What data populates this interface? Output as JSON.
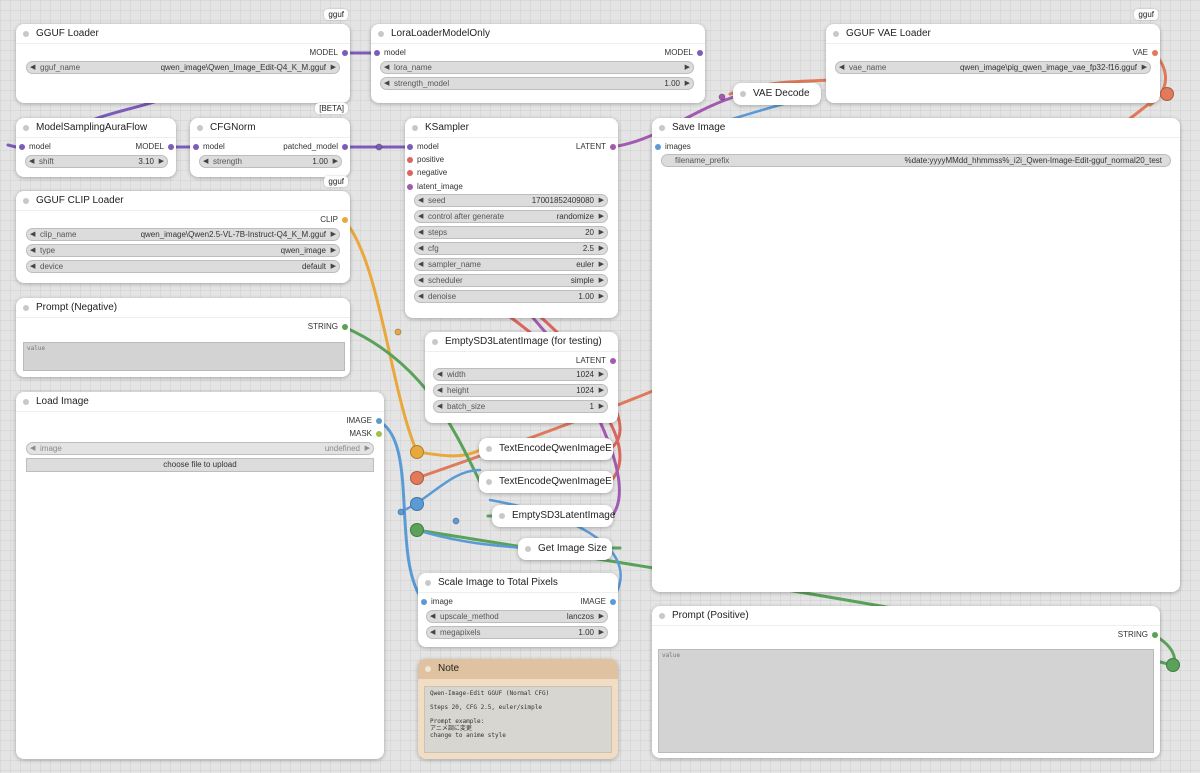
{
  "colors": {
    "model": "#7b5cba",
    "latent": "#a25ab0",
    "clip": "#e8a83c",
    "string": "#5aa25a",
    "image": "#5b9bd5",
    "mask": "#9fbf4a",
    "vae": "#e07a5a",
    "conditioning_pos": "#d9665e",
    "conditioning_neg": "#e89a8c"
  },
  "nodes": {
    "gguf_loader": {
      "badge": "gguf",
      "title": "GGUF Loader",
      "out_model": "MODEL",
      "w_gguf_name": {
        "label": "gguf_name",
        "value": "qwen_image\\Qwen_Image_Edit-Q4_K_M.gguf"
      }
    },
    "lora_loader": {
      "title": "LoraLoaderModelOnly",
      "in_model": "model",
      "out_model": "MODEL",
      "w_lora_name": {
        "label": "lora_name",
        "value": ""
      },
      "w_strength": {
        "label": "strength_model",
        "value": "1.00"
      }
    },
    "vae_decode": {
      "title": "VAE Decode"
    },
    "gguf_vae_loader": {
      "badge": "gguf",
      "title": "GGUF VAE Loader",
      "out_vae": "VAE",
      "w_vae_name": {
        "label": "vae_name",
        "value": "qwen_image\\pig_qwen_image_vae_fp32-f16.gguf"
      }
    },
    "model_sampling": {
      "title": "ModelSamplingAuraFlow",
      "in_model": "model",
      "out_model": "MODEL",
      "w_shift": {
        "label": "shift",
        "value": "3.10"
      }
    },
    "cfg_norm": {
      "badge": "[BETA]",
      "title": "CFGNorm",
      "in_model": "model",
      "out_model": "patched_model",
      "w_strength": {
        "label": "strength",
        "value": "1.00"
      }
    },
    "ksampler": {
      "title": "KSampler",
      "in_model": "model",
      "in_positive": "positive",
      "in_negative": "negative",
      "in_latent": "latent_image",
      "out_latent": "LATENT",
      "w_seed": {
        "label": "seed",
        "value": "17001852409080"
      },
      "w_control": {
        "label": "control after generate",
        "value": "randomize"
      },
      "w_steps": {
        "label": "steps",
        "value": "20"
      },
      "w_cfg": {
        "label": "cfg",
        "value": "2.5"
      },
      "w_sampler": {
        "label": "sampler_name",
        "value": "euler"
      },
      "w_scheduler": {
        "label": "scheduler",
        "value": "simple"
      },
      "w_denoise": {
        "label": "denoise",
        "value": "1.00"
      }
    },
    "save_image": {
      "title": "Save Image",
      "in_images": "images",
      "w_prefix": {
        "label": "filename_prefix",
        "value": "%date:yyyyMMdd_hhmmss%_i2i_Qwen-Image-Edit-gguf_normal20_test"
      }
    },
    "clip_loader": {
      "badge": "gguf",
      "title": "GGUF CLIP Loader",
      "out_clip": "CLIP",
      "w_clip_name": {
        "label": "clip_name",
        "value": "qwen_image\\Qwen2.5-VL-7B-Instruct-Q4_K_M.gguf"
      },
      "w_type": {
        "label": "type",
        "value": "qwen_image"
      },
      "w_device": {
        "label": "device",
        "value": "default"
      }
    },
    "prompt_negative": {
      "title": "Prompt (Negative)",
      "out_string": "STRING",
      "placeholder": "value"
    },
    "load_image": {
      "title": "Load Image",
      "out_image": "IMAGE",
      "out_mask": "MASK",
      "w_image": {
        "label": "image",
        "value": "undefined"
      },
      "upload_label": "choose file to upload"
    },
    "empty_sd3_testing": {
      "title": "EmptySD3LatentImage (for testing)",
      "out_latent": "LATENT",
      "w_width": {
        "label": "width",
        "value": "1024"
      },
      "w_height": {
        "label": "height",
        "value": "1024"
      },
      "w_batch": {
        "label": "batch_size",
        "value": "1"
      }
    },
    "text_encode_1": {
      "title": "TextEncodeQwenImageE"
    },
    "text_encode_2": {
      "title": "TextEncodeQwenImageE"
    },
    "empty_sd3_collapsed": {
      "title": "EmptySD3LatentImage"
    },
    "get_image_size": {
      "title": "Get Image Size"
    },
    "scale_image": {
      "title": "Scale Image to Total Pixels",
      "in_image": "image",
      "out_image": "IMAGE",
      "w_method": {
        "label": "upscale_method",
        "value": "lanczos"
      },
      "w_megapixels": {
        "label": "megapixels",
        "value": "1.00"
      }
    },
    "note": {
      "title": "Note",
      "text": "Qwen-Image-Edit GGUF (Normal CFG)\n\nSteps 20, CFG 2.5, euler/simple\n\nPrompt example:\nアニメ調に変更\nchange to anime style"
    },
    "prompt_positive": {
      "title": "Prompt (Positive)",
      "out_string": "STRING",
      "placeholder": "value"
    }
  }
}
